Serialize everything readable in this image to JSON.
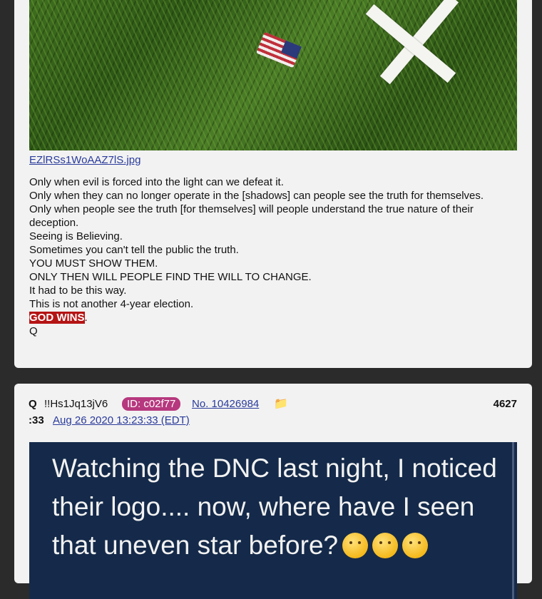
{
  "post1": {
    "file_name": "EZlRSs1WoAAZ7lS.jpg",
    "lines": [
      "Only when evil is forced into the light can we defeat it.",
      "Only when they can no longer operate in the [shadows] can people see the truth for themselves.",
      "Only when people see the truth [for themselves] will people understand the true nature of their deception.",
      "Seeing is Believing.",
      "Sometimes you can't tell the public the truth.",
      "YOU MUST SHOW THEM.",
      "ONLY THEN WILL PEOPLE FIND THE WILL TO CHANGE.",
      "It had to be this way.",
      "This is not another 4-year election."
    ],
    "highlight": "GOD WINS",
    "highlight_suffix": ".",
    "signature": "Q"
  },
  "post2": {
    "author": "Q",
    "tripcode": "!!Hs1Jq13jV6",
    "id_badge": "ID: c02f77",
    "post_no": "No. 10426984",
    "folder_icon": "folder-icon",
    "post_count": "4627",
    "post_count_cont": ":33",
    "timestamp": "Aug 26 2020 13:23:33 (EDT)",
    "image_text": "Watching the DNC last night, I noticed their logo.... now, where have I seen that uneven star before?"
  }
}
